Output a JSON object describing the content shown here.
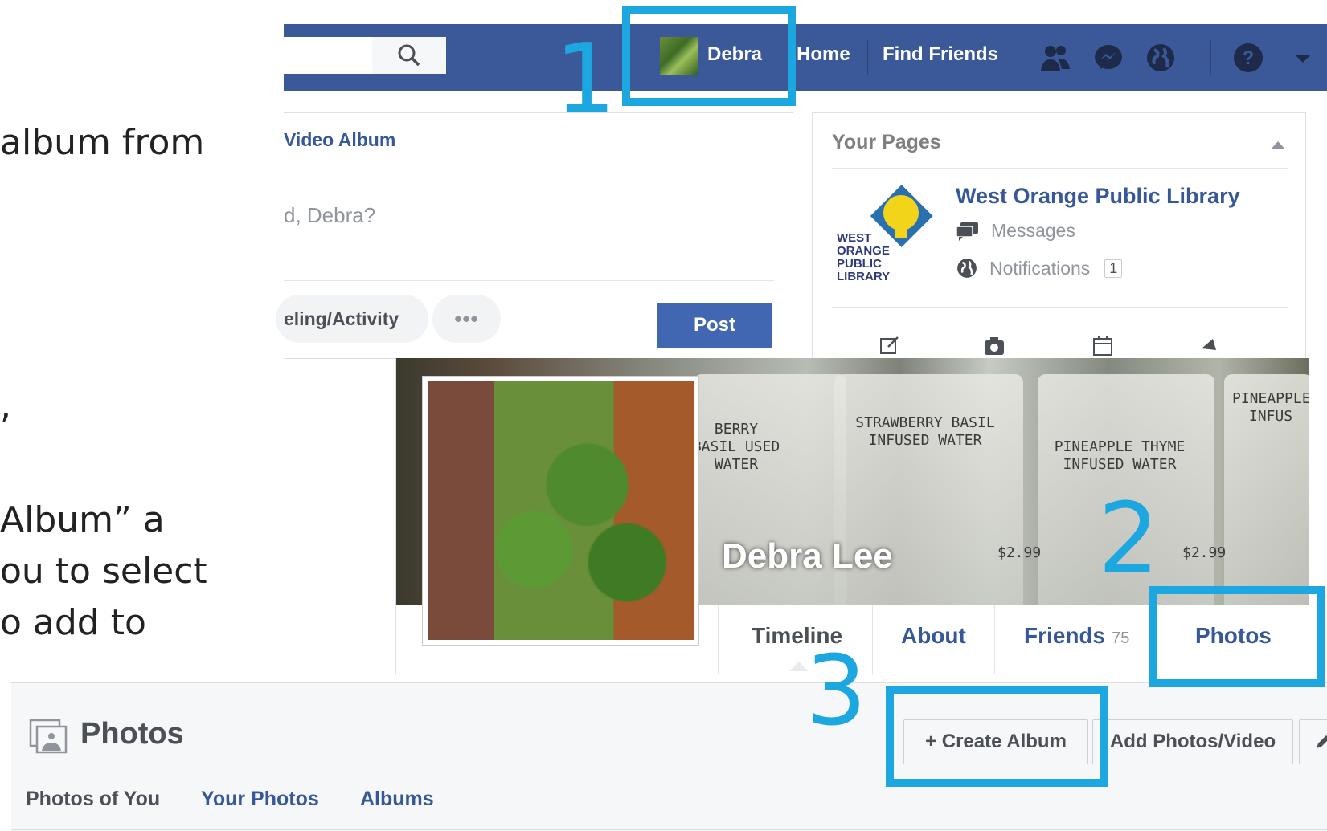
{
  "slide": {
    "line1": "album from",
    "line2": ",",
    "line3": "Album” a",
    "line4": "ou to select",
    "line5": "o add to"
  },
  "topbar": {
    "user": "Debra",
    "home": "Home",
    "find_friends": "Find Friends",
    "icons": [
      "friends-icon",
      "messenger-icon",
      "globe-icon",
      "help-icon",
      "caret-down-icon"
    ]
  },
  "composer": {
    "tab": "Video Album",
    "prompt": "d, Debra?",
    "activity": "eling/Activity",
    "more": "•••",
    "post": "Post"
  },
  "your_pages": {
    "header": "Your Pages",
    "page_name": "West Orange Public Library",
    "logo_text": "WEST ORANGE PUBLIC LIBRARY",
    "messages": "Messages",
    "notifications": "Notifications",
    "notif_count": "1"
  },
  "profile": {
    "name": "Debra Lee",
    "tabs": {
      "timeline": "Timeline",
      "about": "About",
      "friends": "Friends",
      "friends_count": "75",
      "photos": "Photos"
    },
    "cover_labels": [
      "BERRY BASIL USED WATER",
      "STRAWBERRY BASIL INFUSED WATER",
      "PINEAPPLE THYME INFUSED WATER",
      "PINEAPPLE INFUS"
    ],
    "prices": [
      "$2.99",
      "$2.99"
    ]
  },
  "photos_section": {
    "title": "Photos",
    "tabs": [
      "Photos of You",
      "Your Photos",
      "Albums"
    ],
    "create_album": "+ Create Album",
    "add_photos": "Add Photos/Video"
  },
  "annotations": {
    "step1": "1",
    "step2": "2",
    "step3": "3",
    "color": "#1ca7e0"
  }
}
